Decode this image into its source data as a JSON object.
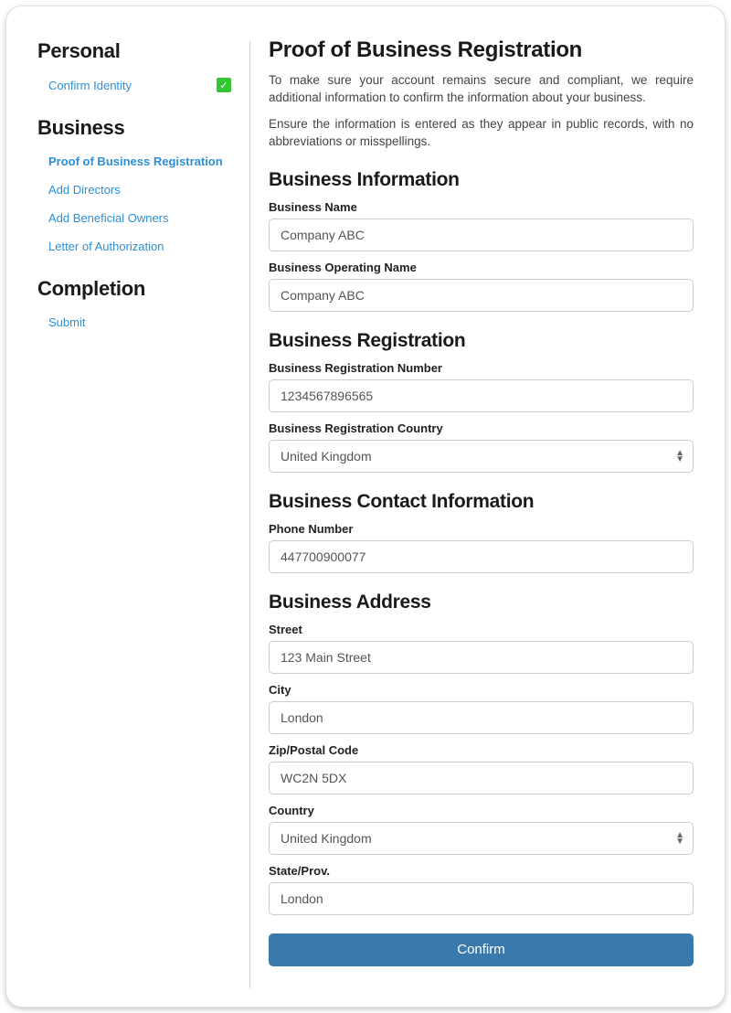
{
  "sidebar": {
    "sections": {
      "personal": {
        "title": "Personal",
        "items": [
          {
            "label": "Confirm Identity",
            "done": true
          }
        ]
      },
      "business": {
        "title": "Business",
        "items": [
          {
            "label": "Proof of Business Registration",
            "active": true
          },
          {
            "label": "Add Directors"
          },
          {
            "label": "Add Beneficial Owners"
          },
          {
            "label": "Letter of Authorization"
          }
        ]
      },
      "completion": {
        "title": "Completion",
        "items": [
          {
            "label": "Submit"
          }
        ]
      }
    }
  },
  "page": {
    "title": "Proof of Business Registration",
    "intro1": "To make sure your account remains secure and compliant, we require additional information to confirm the information about your business.",
    "intro2": "Ensure the information is entered as they appear in public records, with no abbreviations or misspellings."
  },
  "form": {
    "businessInfo": {
      "heading": "Business Information",
      "name": {
        "label": "Business Name",
        "value": "Company ABC"
      },
      "operatingName": {
        "label": "Business Operating Name",
        "value": "Company ABC"
      }
    },
    "businessReg": {
      "heading": "Business Registration",
      "regNumber": {
        "label": "Business Registration Number",
        "value": "1234567896565"
      },
      "regCountry": {
        "label": "Business Registration Country",
        "value": "United Kingdom"
      }
    },
    "contact": {
      "heading": "Business Contact Information",
      "phone": {
        "label": "Phone Number",
        "value": "447700900077"
      }
    },
    "address": {
      "heading": "Business Address",
      "street": {
        "label": "Street",
        "value": "123 Main Street"
      },
      "city": {
        "label": "City",
        "value": "London"
      },
      "zip": {
        "label": "Zip/Postal Code",
        "value": "WC2N 5DX"
      },
      "country": {
        "label": "Country",
        "value": "United Kingdom"
      },
      "state": {
        "label": "State/Prov.",
        "value": "London"
      }
    },
    "confirm": "Confirm"
  }
}
